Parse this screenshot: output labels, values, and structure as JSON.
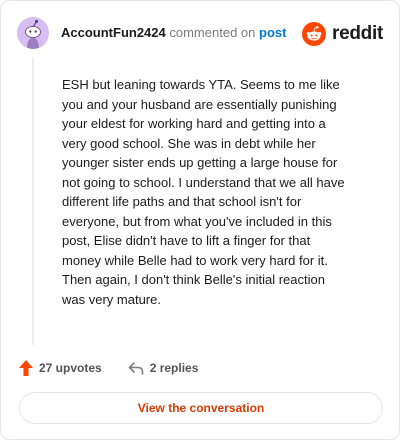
{
  "header": {
    "author": "AccountFun2424",
    "action": "commented on",
    "post_link": "post"
  },
  "logo": {
    "text": "reddit",
    "icon": "reddit-snoo-icon",
    "color": "#ff4500"
  },
  "avatar": {
    "icon": "snoo-avatar-icon",
    "color": "#d8bdf0"
  },
  "comment": {
    "lines": [
      "ESH but leaning towards YTA. Seems to me like",
      "you and your husband are essentially punishing",
      "your eldest for working hard and getting into a",
      "very good school. She was in debt while her",
      "younger sister ends up getting a large house for",
      "not going to school. I understand that we all have",
      "different life paths and that school isn't for",
      "everyone, but from what you've included in this",
      "post, Elise didn't have to lift a finger for that",
      "money while Belle had to work very hard for it.",
      "Then again, I don't think Belle's initial reaction",
      "was very mature."
    ]
  },
  "footer": {
    "upvotes": "27 upvotes",
    "replies": "2 replies",
    "upvote_icon": "upvote-arrow-icon",
    "reply_icon": "reply-arrow-icon",
    "upvote_color": "#ff4500"
  },
  "cta": {
    "label": "View the conversation",
    "color": "#d93a00"
  }
}
